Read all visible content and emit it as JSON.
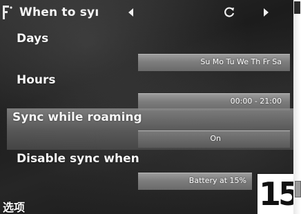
{
  "titlebar": {
    "title": "When to syı",
    "icons": [
      "app-menu-icon",
      "arrow-left-icon",
      "sync-icon",
      "arrow-right-icon"
    ]
  },
  "settings": [
    {
      "label": "Days",
      "value": "Su Mo Tu We Th Fr Sa"
    },
    {
      "label": "Hours",
      "value": "00:00 - 21:00"
    },
    {
      "label": "Sync while roaming",
      "value": "On"
    },
    {
      "label": "Disable sync when",
      "value": "Battery at 15%"
    }
  ],
  "softkeys": {
    "left": "选项"
  },
  "badge": {
    "number": "15"
  },
  "colors": {
    "background": "#1e1e1e",
    "value_box": "#7f7f7f",
    "highlight": "#6a6a6a",
    "text": "#f4f4f4"
  }
}
